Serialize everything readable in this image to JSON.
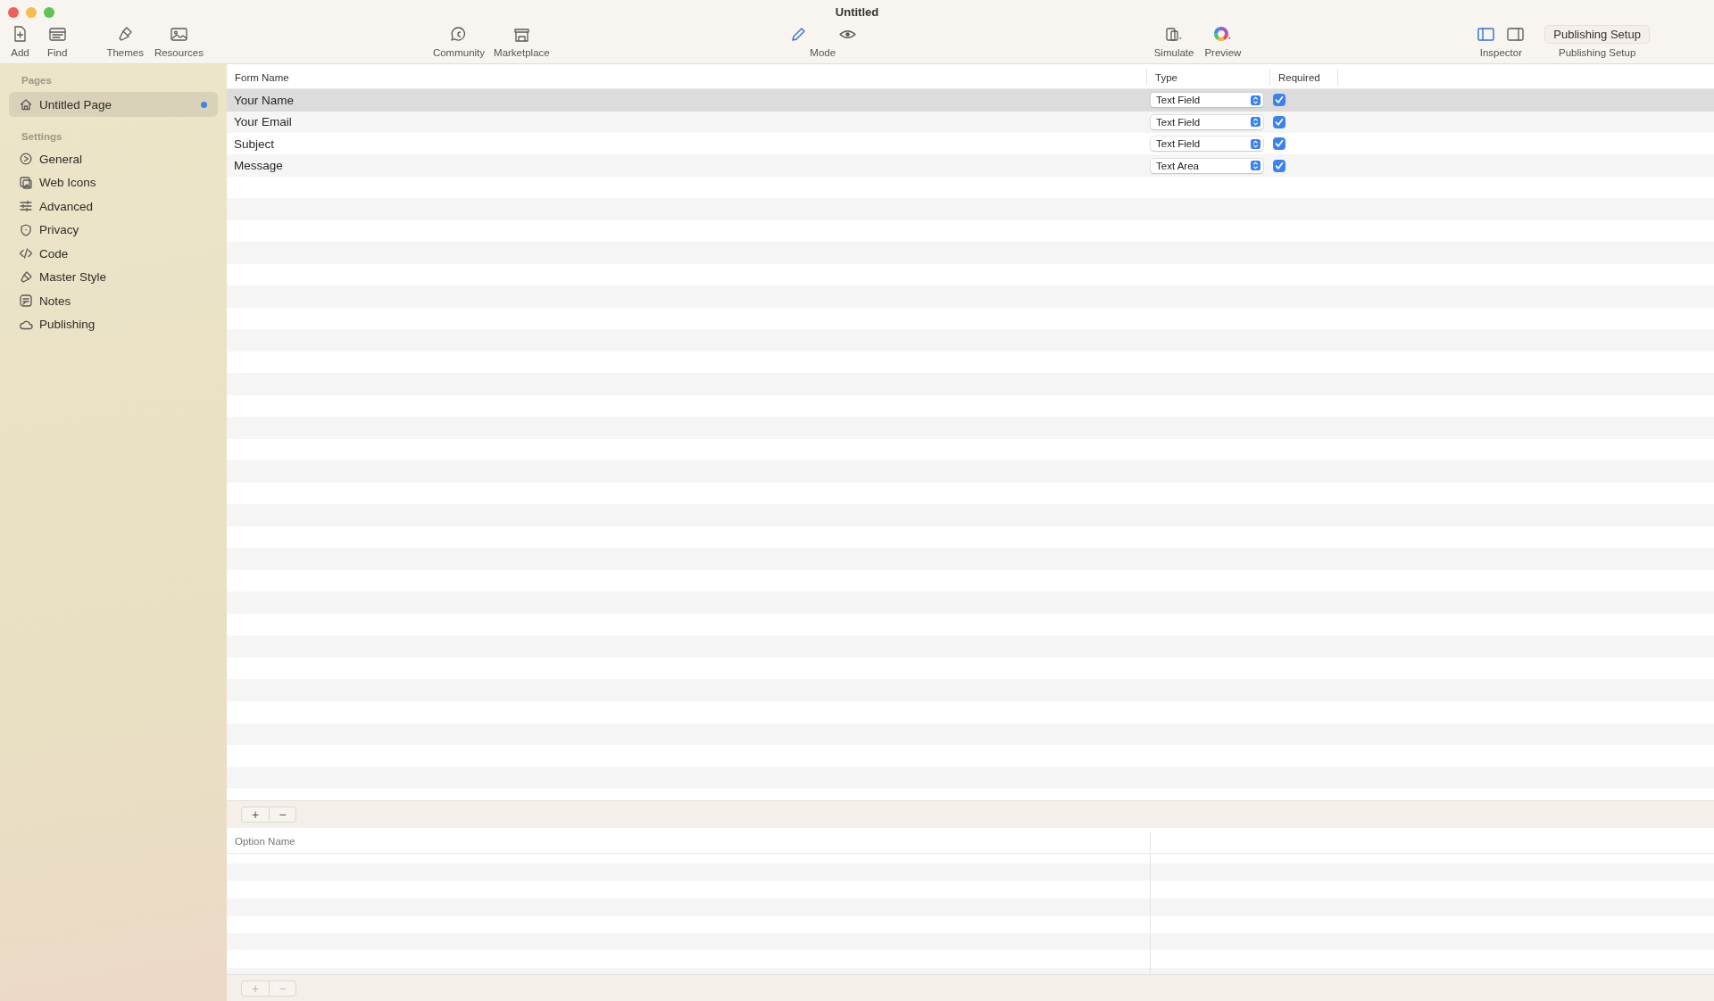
{
  "window": {
    "title": "Untitled"
  },
  "toolbar": [
    {
      "kind": "tool",
      "label": "Add"
    },
    {
      "kind": "tool",
      "label": "Find"
    },
    {
      "kind": "tool",
      "label": "Themes"
    },
    {
      "kind": "tool",
      "label": "Resources"
    },
    {
      "kind": "tool",
      "label": "Community"
    },
    {
      "kind": "tool",
      "label": "Marketplace"
    },
    {
      "kind": "segmented",
      "label": "Mode",
      "segments": [
        {
          "selected": true
        },
        {
          "selected": false
        }
      ]
    },
    {
      "kind": "menu",
      "label": "Simulate"
    },
    {
      "kind": "menu",
      "label": "Preview"
    },
    {
      "kind": "segmented",
      "label": "Inspector",
      "segments": [
        {
          "selected": true
        },
        {
          "selected": false
        }
      ]
    },
    {
      "kind": "button",
      "label": "Publishing Setup",
      "button": "Publishing Setup"
    }
  ],
  "sidebar": {
    "sections": [
      {
        "title": "Pages",
        "items": [
          {
            "label": "Untitled Page",
            "selected": true,
            "modified": true
          }
        ]
      },
      {
        "title": "Settings",
        "items": [
          {
            "label": "General",
            "selected": false
          },
          {
            "label": "Web Icons",
            "selected": false
          },
          {
            "label": "Advanced",
            "selected": false
          },
          {
            "label": "Privacy",
            "selected": false
          },
          {
            "label": "Code",
            "selected": false
          },
          {
            "label": "Master Style",
            "selected": false
          },
          {
            "label": "Notes",
            "selected": false
          },
          {
            "label": "Publishing",
            "selected": false
          }
        ]
      }
    ]
  },
  "form_table": {
    "columns": [
      "Form Name",
      "Type",
      "Required"
    ],
    "rows": [
      {
        "name": "Your Name",
        "type": "Text Field",
        "required": true,
        "selected": true
      },
      {
        "name": "Your Email",
        "type": "Text Field",
        "required": true,
        "selected": false
      },
      {
        "name": "Subject",
        "type": "Text Field",
        "required": true,
        "selected": false
      },
      {
        "name": "Message",
        "type": "Text Area",
        "required": true,
        "selected": false
      }
    ]
  },
  "form_buttons": [
    {
      "label": "+",
      "disabled": false
    },
    {
      "label": "−",
      "disabled": false
    }
  ],
  "option_table": {
    "columns": [
      "Option Name"
    ]
  },
  "option_buttons": [
    {
      "label": "+",
      "disabled": true
    },
    {
      "label": "−",
      "disabled": true
    }
  ]
}
